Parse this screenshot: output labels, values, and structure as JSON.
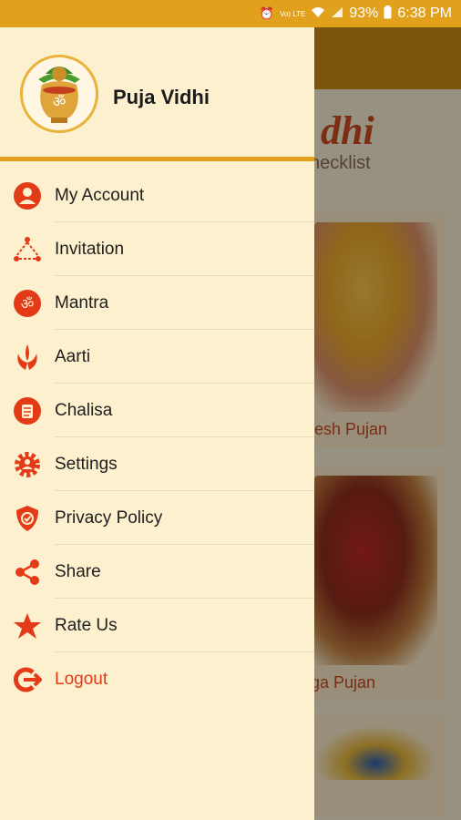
{
  "status_bar": {
    "battery": "93%",
    "time": "6:38 PM",
    "network_badge": "Vo) LTE"
  },
  "drawer": {
    "app_name": "Puja Vidhi",
    "items": [
      {
        "label": "My Account",
        "icon": "user-icon"
      },
      {
        "label": "Invitation",
        "icon": "invitation-icon"
      },
      {
        "label": "Mantra",
        "icon": "om-icon"
      },
      {
        "label": "Aarti",
        "icon": "aarti-icon"
      },
      {
        "label": "Chalisa",
        "icon": "chalisa-icon"
      },
      {
        "label": "Settings",
        "icon": "gear-icon"
      },
      {
        "label": "Privacy Policy",
        "icon": "shield-icon"
      },
      {
        "label": "Share",
        "icon": "share-icon"
      },
      {
        "label": "Rate Us",
        "icon": "star-icon"
      },
      {
        "label": "Logout",
        "icon": "logout-icon"
      }
    ]
  },
  "background": {
    "title_partial": "dhi",
    "subtitle_partial": "hecklist",
    "cards": [
      {
        "label": "nesh Pujan"
      },
      {
        "label": "rga Pujan"
      }
    ]
  },
  "colors": {
    "accent": "#e2a11d",
    "icon_red": "#e33b17",
    "drawer_bg": "#fdf0cf"
  }
}
